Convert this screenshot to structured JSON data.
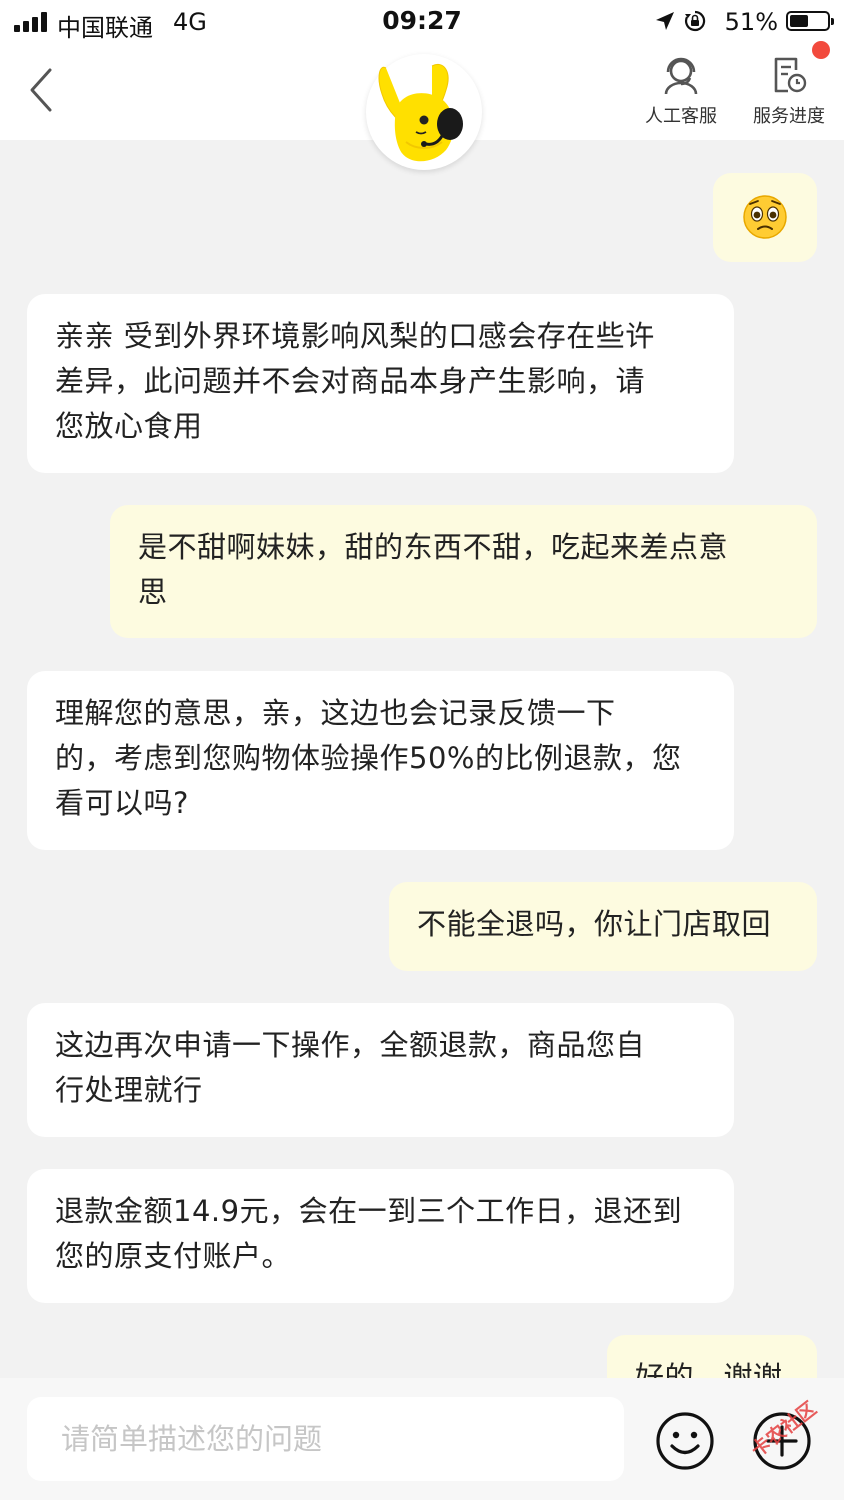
{
  "status_bar": {
    "carrier": "中国联通",
    "network": "4G",
    "time": "09:27",
    "battery_percent": "51%",
    "battery_level": 0.51,
    "icons": [
      "signal-icon",
      "location-arrow-icon",
      "orientation-lock-icon",
      "battery-icon"
    ]
  },
  "header": {
    "back_icon": "chevron-left-icon",
    "avatar_icon": "yellow-rabbit-mascot-icon",
    "actions": [
      {
        "label": "人工客服",
        "icon": "headset-agent-icon"
      },
      {
        "label": "服务进度",
        "icon": "document-clock-icon",
        "badge_color": "#f24a3d"
      }
    ]
  },
  "messages": [
    {
      "from": "user",
      "type": "emoji",
      "emoji": "pleading-face-emoji"
    },
    {
      "from": "agent",
      "lines": [
        "亲亲 受到外界环境影响风梨的口感会存在些许",
        "差异，此问题并不会对商品本身产生影响，请",
        "您放心食用"
      ]
    },
    {
      "from": "user",
      "lines": [
        "是不甜啊妹妹，甜的东西不甜，吃起来差点意",
        "思"
      ]
    },
    {
      "from": "agent",
      "lines": [
        "理解您的意思，亲，这边也会记录反馈一下",
        "的，考虑到您购物体验操作50%的比例退款，您",
        "看可以吗?"
      ]
    },
    {
      "from": "user",
      "lines": [
        "不能全退吗，你让门店取回"
      ]
    },
    {
      "from": "agent",
      "lines": [
        "这边再次申请一下操作，全额退款，商品您自",
        "行处理就行"
      ]
    },
    {
      "from": "agent",
      "lines": [
        "退款金额14.9元，会在一到三个工作日，退还到",
        "您的原支付账户。"
      ]
    },
    {
      "from": "user",
      "lines": [
        "好的，谢谢"
      ]
    }
  ],
  "input_bar": {
    "placeholder": "请简单描述您的问题",
    "emoji_icon": "smiley-face-icon",
    "more_icon": "plus-circle-icon"
  },
  "watermark": {
    "text": "卡农社区",
    "color": "#e54040"
  },
  "colors": {
    "agent_bubble": "#ffffff",
    "user_bubble": "#fdfbe0",
    "chat_background": "#f2f2f2",
    "mascot_yellow": "#ffe000"
  }
}
